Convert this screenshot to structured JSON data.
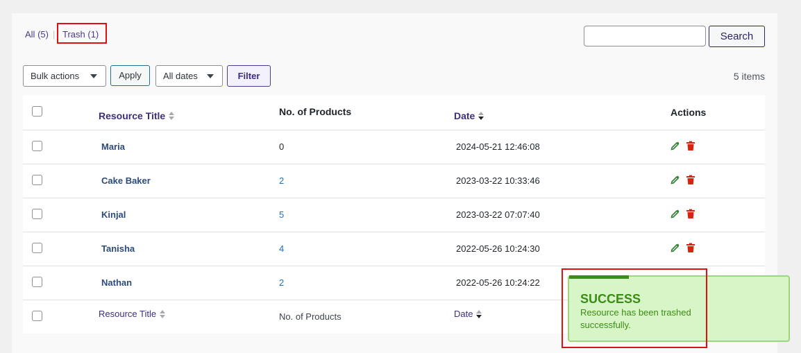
{
  "views": {
    "all_label": "All",
    "all_count": "(5)",
    "separator": "|",
    "trash_label": "Trash (1)"
  },
  "search": {
    "value": "",
    "button_label": "Search"
  },
  "bulk_actions": {
    "selected": "Bulk actions",
    "apply_label": "Apply"
  },
  "date_filter": {
    "selected": "All dates",
    "filter_label": "Filter"
  },
  "item_count": "5 items",
  "table": {
    "columns": {
      "title": "Resource Title",
      "products": "No. of Products",
      "date": "Date",
      "actions": "Actions"
    },
    "rows": [
      {
        "title": "Maria",
        "products": "0",
        "date": "2024-05-21 12:46:08"
      },
      {
        "title": "Cake Baker",
        "products": "2",
        "date": "2023-03-22 10:33:46"
      },
      {
        "title": "Kinjal",
        "products": "5",
        "date": "2023-03-22 07:07:40"
      },
      {
        "title": "Tanisha",
        "products": "4",
        "date": "2022-05-26 10:24:30"
      },
      {
        "title": "Nathan",
        "products": "2",
        "date": "2022-05-26 10:24:22"
      }
    ]
  },
  "toast": {
    "title": "SUCCESS",
    "message": "Resource has been trashed successfully."
  },
  "colors": {
    "accent": "#3a2f80",
    "success": "#3a8c14",
    "delete": "#d63638",
    "edit": "#2e7d32"
  }
}
